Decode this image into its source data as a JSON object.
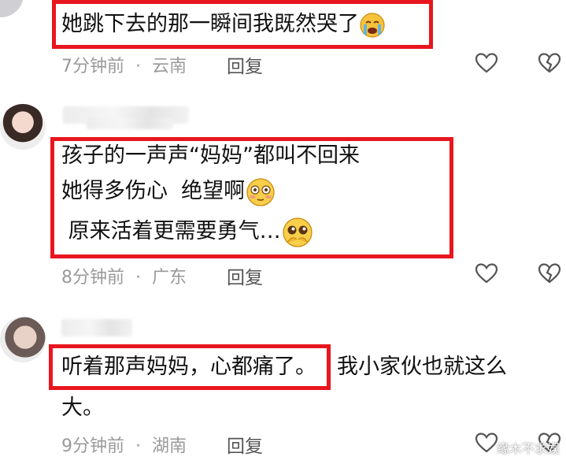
{
  "comments": [
    {
      "lines": [
        "她跳下去的那一瞬间我既然哭了"
      ],
      "time": "7分钟前",
      "location": "云南",
      "reply_label": "回复"
    },
    {
      "lines": [
        "孩子的一声声“妈妈”都叫不回来",
        "她得多伤心  绝望啊",
        " 原来活着更需要勇气…"
      ],
      "time": "8分钟前",
      "location": "广东",
      "reply_label": "回复"
    },
    {
      "lines": [
        "听着那声妈妈，心都痛了。",
        "我小家伙也就这么",
        "大。"
      ],
      "time": "9分钟前",
      "location": "湖南",
      "reply_label": "回复"
    }
  ],
  "separator": "·",
  "watermark": "缘木不求娱",
  "colors": {
    "highlight": "#e8161e",
    "meta": "#9a9a9a"
  }
}
